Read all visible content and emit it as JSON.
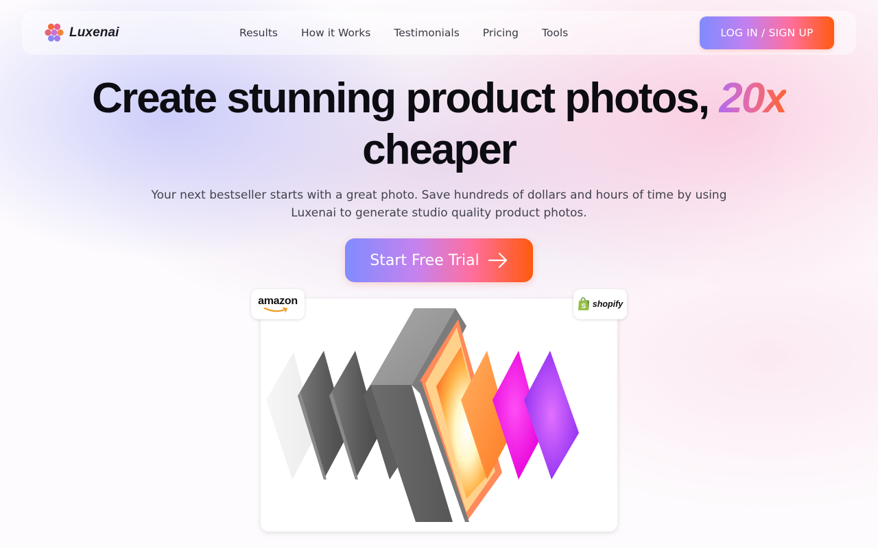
{
  "brand": {
    "name": "Luxenai",
    "icon": "hexagon-cluster-logo-icon"
  },
  "nav": {
    "links": [
      {
        "label": "Results"
      },
      {
        "label": "How it Works"
      },
      {
        "label": "Testimonials"
      },
      {
        "label": "Pricing"
      },
      {
        "label": "Tools"
      }
    ],
    "login_label": "LOG IN / SIGN UP"
  },
  "hero": {
    "title_main": "Create stunning product photos, ",
    "title_accent": "20x",
    "title_end": "cheaper",
    "subtitle": "Your next bestseller starts with a great photo. Save hundreds of dollars and hours of time by using Luxenai to generate studio quality product photos.",
    "cta_label": "Start Free Trial",
    "cta_icon": "arrow-right-icon"
  },
  "badges": {
    "amazon": "amazon",
    "shopify": "shopify"
  },
  "colors": {
    "gradient_start": "#7f8bff",
    "gradient_mid": "#ff6f9a",
    "gradient_end": "#ff5a10",
    "title_text": "#0c0c12"
  }
}
